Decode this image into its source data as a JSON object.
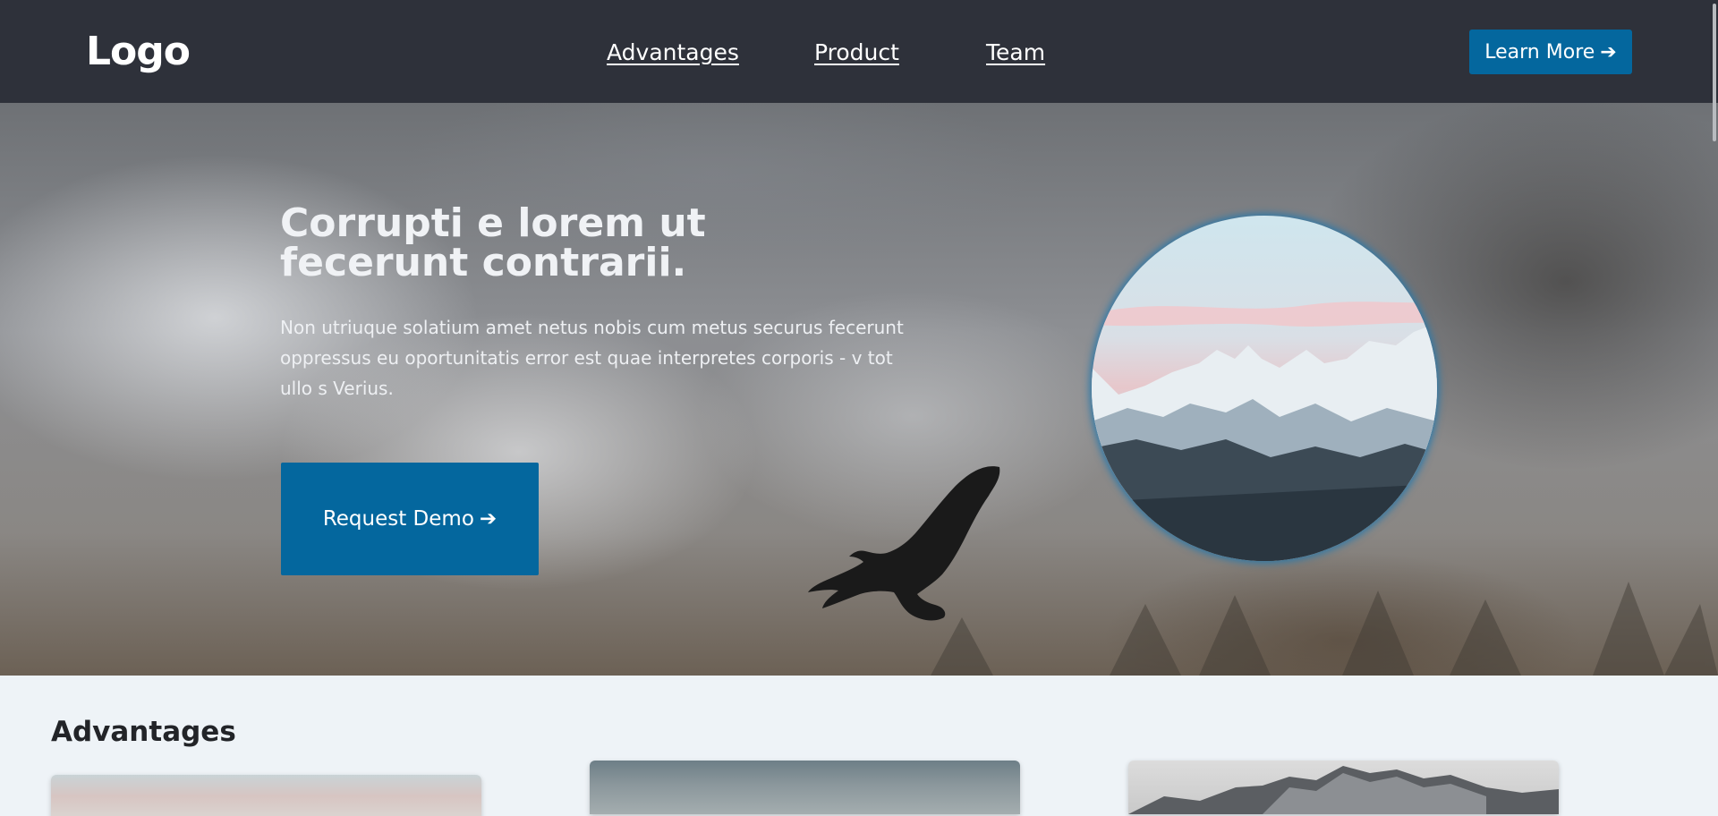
{
  "header": {
    "logo": "Logo",
    "nav": [
      "Advantages",
      "Product",
      "Team"
    ],
    "cta_label": "Learn More",
    "cta_arrow": "➔"
  },
  "hero": {
    "title": "Corrupti e lorem ut fecerunt contrarii.",
    "text": "Non utriuque solatium amet netus nobis cum metus securus fecerunt oppressus eu oportunitatis error est quae interpretes corporis - v tot ullo s Verius.",
    "button_label": "Request Demo",
    "button_arrow": "➔"
  },
  "advantages": {
    "title": "Advantages"
  },
  "colors": {
    "header_bg": "#2e313a",
    "accent": "#04679e",
    "page_bg": "#eef3f7"
  },
  "icons": {
    "arrow": "arrow-right-icon",
    "bird": "eagle-silhouette-icon"
  }
}
